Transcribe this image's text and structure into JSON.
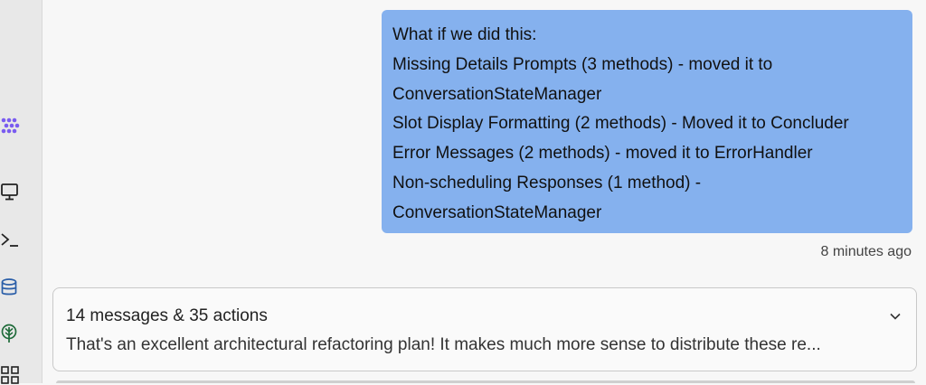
{
  "sidebar": {
    "icons": [
      "agent-icon",
      "monitor-icon",
      "terminal-icon",
      "database-icon",
      "git-tree-icon",
      "apps-grid-icon"
    ],
    "accent_color": "#7a5cf0"
  },
  "conversation": {
    "user_message": {
      "lines": [
        "What if we did this:",
        "Missing Details Prompts (3 methods) - moved it to",
        "ConversationStateManager",
        "Slot Display Formatting (2 methods) - Moved it to Concluder",
        "Error Messages (2 methods) - moved it to ErrorHandler",
        "Non-scheduling Responses (1 method) -",
        "ConversationStateManager"
      ],
      "bubble_color": "#85b1ee",
      "timestamp": "8 minutes ago"
    },
    "agent_summary": {
      "title": "14 messages & 35 actions",
      "preview": "That's an excellent architectural refactoring plan! It makes much more sense to distribute these re...",
      "expand_icon": "chevron-down-icon"
    }
  }
}
